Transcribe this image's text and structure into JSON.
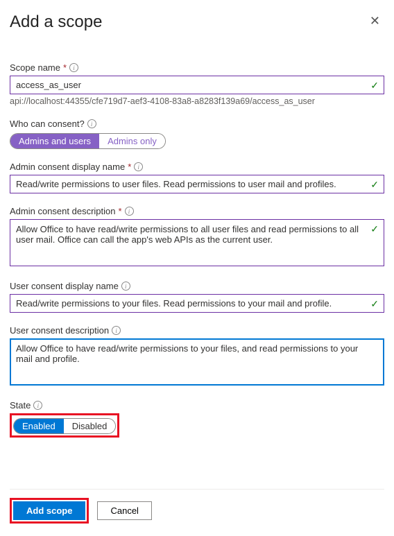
{
  "header": {
    "title": "Add a scope"
  },
  "scopeName": {
    "label": "Scope name",
    "value": "access_as_user",
    "uri": "api://localhost:44355/cfe719d7-aef3-4108-83a8-a8283f139a69/access_as_user"
  },
  "consent": {
    "label": "Who can consent?",
    "optionA": "Admins and users",
    "optionB": "Admins only"
  },
  "adminDisplay": {
    "label": "Admin consent display name",
    "value": "Read/write permissions to user files. Read permissions to user mail and profiles."
  },
  "adminDesc": {
    "label": "Admin consent description",
    "value": "Allow Office to have read/write permissions to all user files and read permissions to all user mail. Office can call the app's web APIs as the current user."
  },
  "userDisplay": {
    "label": "User consent display name",
    "value": "Read/write permissions to your files. Read permissions to your mail and profile."
  },
  "userDesc": {
    "label": "User consent description",
    "value": "Allow Office to have read/write permissions to your files, and read permissions to your mail and profile."
  },
  "state": {
    "label": "State",
    "optionA": "Enabled",
    "optionB": "Disabled"
  },
  "footer": {
    "primary": "Add scope",
    "cancel": "Cancel"
  }
}
